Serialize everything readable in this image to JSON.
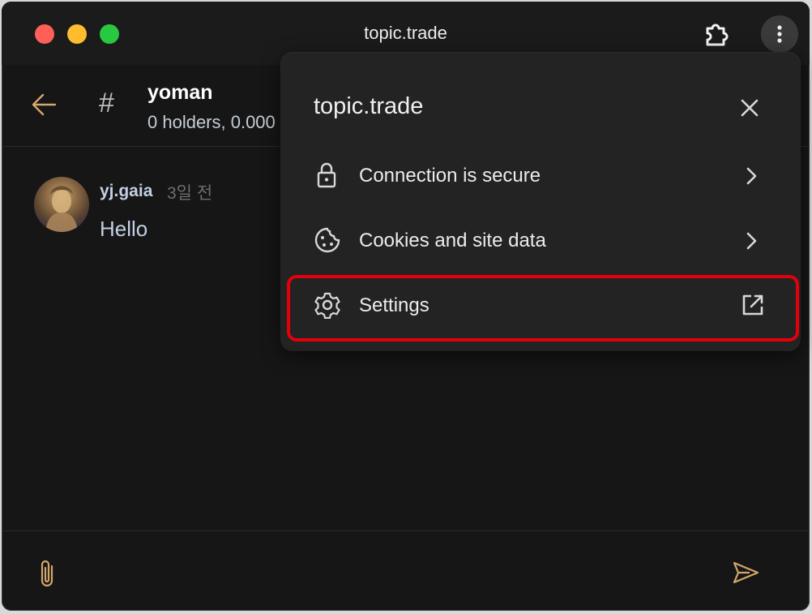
{
  "window": {
    "title": "topic.trade"
  },
  "icons": {
    "extension": "puzzle-icon",
    "more": "more-vertical-icon",
    "back": "arrow-left-icon",
    "hash": "hash-icon",
    "attach": "paperclip-icon",
    "send": "send-icon",
    "lock": "lock-icon",
    "cookie": "cookie-icon",
    "gear": "gear-icon",
    "chevron": "chevron-right-icon",
    "external": "external-link-icon",
    "close": "close-icon"
  },
  "channel": {
    "hash": "#",
    "name": "yoman",
    "subtitle": "0 holders, 0.000"
  },
  "messages": [
    {
      "user": "yj.gaia",
      "time": "3일 전",
      "text": "Hello"
    }
  ],
  "popup": {
    "title": "topic.trade",
    "items": [
      {
        "label": "Connection is secure"
      },
      {
        "label": "Cookies and site data"
      },
      {
        "label": "Settings"
      }
    ]
  },
  "colors": {
    "accent": "#d3a86a",
    "highlight": "#e3000b",
    "background": "#161616",
    "popup": "#232323"
  }
}
